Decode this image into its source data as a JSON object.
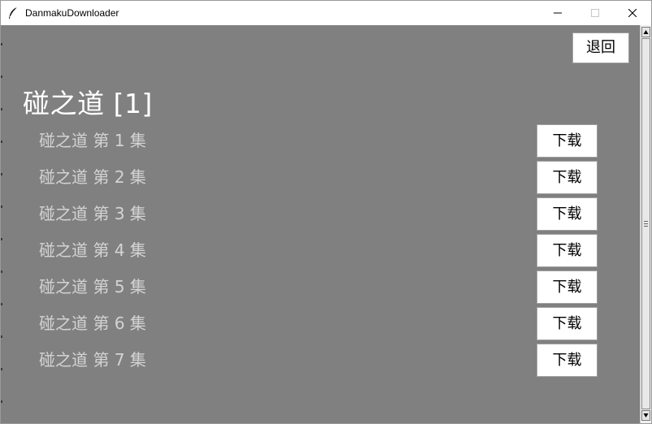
{
  "window": {
    "title": "DanmakuDownloader"
  },
  "toolbar": {
    "back_label": "退回"
  },
  "show": {
    "title": "碰之道 [1]"
  },
  "episodes": [
    {
      "label": "碰之道 第 1 集",
      "download_label": "下载"
    },
    {
      "label": "碰之道 第 2 集",
      "download_label": "下载"
    },
    {
      "label": "碰之道 第 3 集",
      "download_label": "下载"
    },
    {
      "label": "碰之道 第 4 集",
      "download_label": "下载"
    },
    {
      "label": "碰之道 第 5 集",
      "download_label": "下载"
    },
    {
      "label": "碰之道 第 6 集",
      "download_label": "下载"
    },
    {
      "label": "碰之道 第 7 集",
      "download_label": "下载"
    }
  ],
  "colors": {
    "background": "#808080",
    "title_text": "#ffffff",
    "episode_text": "#d3d3d3"
  },
  "icons": {
    "app": "feather-icon",
    "minimize": "minimize-icon",
    "maximize": "maximize-icon",
    "close": "close-icon"
  }
}
